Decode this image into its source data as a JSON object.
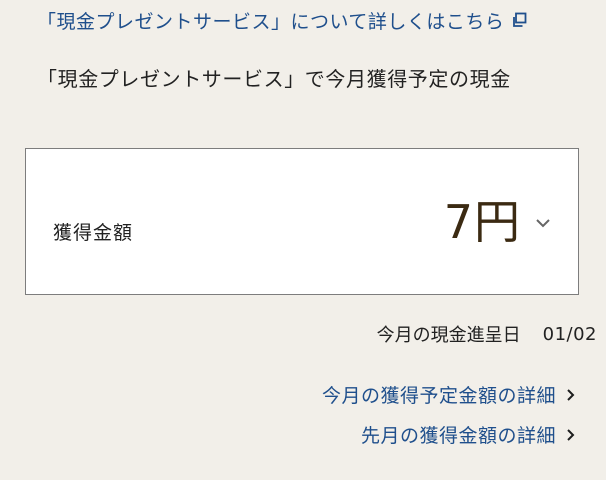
{
  "header_link": {
    "label": "「現金プレゼントサービス」について詳しくはこちら",
    "icon": "external-link-icon"
  },
  "headline": "「現金プレゼントサービス」で今月獲得予定の現金",
  "amount_card": {
    "label": "獲得金額",
    "value": "7円",
    "toggle_icon": "chevron-down-icon"
  },
  "payout": {
    "label": "今月の現金進呈日",
    "date": "01/02"
  },
  "links": [
    {
      "label": "今月の獲得予定金額の詳細",
      "icon": "chevron-right-icon"
    },
    {
      "label": "先月の獲得金額の詳細",
      "icon": "chevron-right-icon"
    }
  ],
  "colors": {
    "background": "#f2efe9",
    "link": "#1f4f8c",
    "amount": "#3b2a12",
    "card_border": "#7d7d7d"
  }
}
